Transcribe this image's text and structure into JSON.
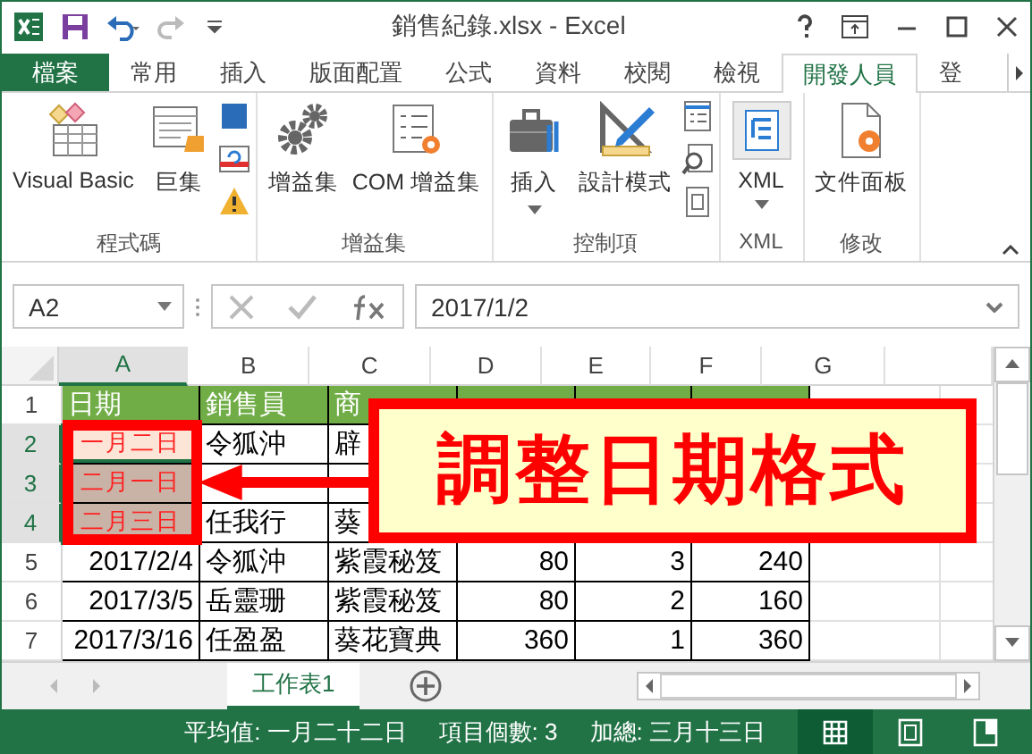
{
  "window": {
    "title": "銷售紀錄.xlsx - Excel"
  },
  "tabs": [
    {
      "label": "檔案",
      "kind": "file",
      "selected": false
    },
    {
      "label": "常用",
      "kind": "tab",
      "selected": false
    },
    {
      "label": "插入",
      "kind": "tab",
      "selected": false
    },
    {
      "label": "版面配置",
      "kind": "tab",
      "selected": false
    },
    {
      "label": "公式",
      "kind": "tab",
      "selected": false
    },
    {
      "label": "資料",
      "kind": "tab",
      "selected": false
    },
    {
      "label": "校閱",
      "kind": "tab",
      "selected": false
    },
    {
      "label": "檢視",
      "kind": "tab",
      "selected": false
    },
    {
      "label": "開發人員",
      "kind": "tab",
      "selected": true
    },
    {
      "label": "登",
      "kind": "tab",
      "selected": false
    }
  ],
  "ribbon": {
    "groups": [
      {
        "label": "程式碼",
        "buttons": [
          {
            "label": "Visual Basic",
            "kind": "vba",
            "dropdown": false
          },
          {
            "label": "巨集",
            "kind": "macro",
            "dropdown": false
          }
        ],
        "small": [
          {
            "kind": "record"
          },
          {
            "kind": "relative"
          },
          {
            "kind": "warning"
          }
        ]
      },
      {
        "label": "增益集",
        "buttons": [
          {
            "label": "增益集",
            "kind": "gears",
            "dropdown": false
          },
          {
            "label": "COM 增益集",
            "kind": "com",
            "dropdown": false
          }
        ]
      },
      {
        "label": "控制項",
        "buttons": [
          {
            "label": "插入",
            "kind": "toolbox",
            "dropdown": true
          },
          {
            "label": "設計模式",
            "kind": "design",
            "dropdown": false
          }
        ],
        "small": [
          {
            "kind": "properties"
          },
          {
            "kind": "viewcode"
          },
          {
            "kind": "dialog"
          }
        ]
      },
      {
        "label": "XML",
        "buttons": [
          {
            "label": "XML",
            "kind": "xml",
            "dropdown": true
          }
        ]
      },
      {
        "label": "修改",
        "buttons": [
          {
            "label": "文件面板",
            "kind": "docpanel",
            "dropdown": false
          }
        ]
      }
    ]
  },
  "formula_bar": {
    "name_box": "A2",
    "value": "2017/1/2"
  },
  "sheet": {
    "columns": [
      {
        "label": "A",
        "selected": true
      },
      {
        "label": "B",
        "selected": false
      },
      {
        "label": "C",
        "selected": false
      },
      {
        "label": "D",
        "selected": false
      },
      {
        "label": "E",
        "selected": false
      },
      {
        "label": "F",
        "selected": false
      },
      {
        "label": "G",
        "selected": false
      }
    ],
    "rows": [
      {
        "number": "1",
        "selected": false,
        "active": false,
        "cells": [
          {
            "text": "日期",
            "kind": "header"
          },
          {
            "text": "銷售員",
            "kind": "header"
          },
          {
            "text": "商",
            "kind": "header"
          },
          {
            "kind": "header"
          },
          {
            "kind": "header"
          },
          {
            "kind": "header"
          }
        ]
      },
      {
        "number": "2",
        "selected": true,
        "active": true,
        "cells": [
          {
            "text": "一月二日",
            "kind": "date-cn"
          },
          {
            "text": "令狐沖",
            "kind": "text"
          },
          {
            "text": "辟",
            "kind": "text"
          }
        ]
      },
      {
        "number": "3",
        "selected": true,
        "active": false,
        "cells": [
          {
            "text": "二月一日",
            "kind": "date-cn"
          },
          {
            "kind": "text"
          },
          {
            "kind": "text"
          },
          {
            "kind": "number"
          },
          {
            "kind": "number"
          },
          {
            "kind": "number"
          }
        ]
      },
      {
        "number": "4",
        "selected": true,
        "active": false,
        "cells": [
          {
            "text": "二月三日",
            "kind": "date-cn"
          },
          {
            "text": "任我行",
            "kind": "text"
          },
          {
            "text": "葵",
            "kind": "text"
          },
          {
            "kind": "number"
          },
          {
            "kind": "number"
          },
          {
            "kind": "number"
          }
        ]
      },
      {
        "number": "5",
        "selected": false,
        "active": false,
        "cells": [
          {
            "text": "2017/2/4",
            "kind": "number"
          },
          {
            "text": "令狐沖",
            "kind": "text"
          },
          {
            "text": "紫霞秘笈",
            "kind": "text"
          },
          {
            "text": "80",
            "kind": "number"
          },
          {
            "text": "3",
            "kind": "number"
          },
          {
            "text": "240",
            "kind": "number"
          }
        ]
      },
      {
        "number": "6",
        "selected": false,
        "active": false,
        "cells": [
          {
            "text": "2017/3/5",
            "kind": "number"
          },
          {
            "text": "岳靈珊",
            "kind": "text"
          },
          {
            "text": "紫霞秘笈",
            "kind": "text"
          },
          {
            "text": "80",
            "kind": "number"
          },
          {
            "text": "2",
            "kind": "number"
          },
          {
            "text": "160",
            "kind": "number"
          }
        ]
      },
      {
        "number": "7",
        "selected": false,
        "active": false,
        "cells": [
          {
            "text": "2017/3/16",
            "kind": "number"
          },
          {
            "text": "任盈盈",
            "kind": "text"
          },
          {
            "text": "葵花寶典",
            "kind": "text"
          },
          {
            "text": "360",
            "kind": "number"
          },
          {
            "text": "1",
            "kind": "number"
          },
          {
            "text": "360",
            "kind": "number"
          }
        ]
      }
    ]
  },
  "callout": {
    "text": "調整日期格式"
  },
  "sheet_tabs": [
    {
      "label": "工作表1",
      "selected": true
    }
  ],
  "status_bar": {
    "items": [
      "平均值: 一月二十二日",
      "項目個數: 3",
      "加總: 三月十三日"
    ],
    "views": [
      {
        "kind": "normal",
        "selected": true
      },
      {
        "kind": "layout",
        "selected": false
      },
      {
        "kind": "pagebreak",
        "selected": false
      }
    ]
  }
}
